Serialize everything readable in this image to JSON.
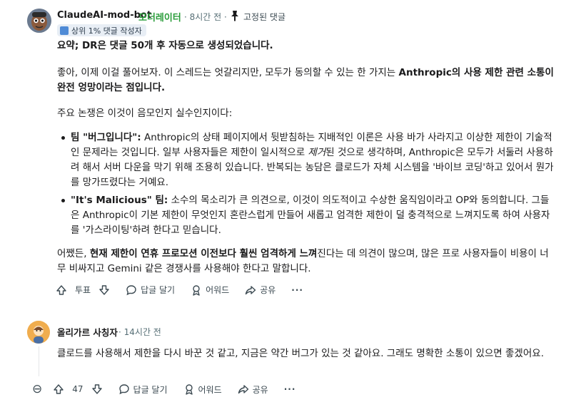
{
  "comment1": {
    "author": "ClaudeAI-mod-bot",
    "role_badge": "모더레이터",
    "meta": "· 8시간 전 ·",
    "pinned_label": "고정된 댓글",
    "top_badge": "상위 1% 댓글 작성자",
    "tldr": "요약; DR은 댓글 50개 후 자동으로 생성되었습니다.",
    "p1_normal": "좋아, 이제 이걸 풀어보자. 이 스레드는 엇갈리지만, 모두가 동의할 수 있는 한 가지는 ",
    "p1_bold": "Anthropic의 사용 제한 관련 소통이 완전 엉망이라는 점입니다.",
    "p2": "주요 논쟁은 이것이 음모인지 실수인지이다:",
    "bullet1_bold": "팀 \"버그입니다\":",
    "bullet1_a": " Anthropic의 상태 페이지에서 뒷받침하는 지배적인 이론은 사용 바가 사라지고 이상한 제한이 기술적인 문제라는 것입니다. 일부 사용자들은 제한이 일시적으로 ",
    "bullet1_italic": "제거",
    "bullet1_b": "된 것으로 생각하며, Anthropic은 모두가 서둘러 사용하려 해서 서버 다운을 막기 위해 조용히 있습니다. 반복되는 농담은 클로드가 자체 시스템을 '바이브 코딩'하고 있어서 뭔가를 망가뜨렸다는 거예요.",
    "bullet2_bold": "\"It's Malicious\" 팀:",
    "bullet2_text": " 소수의 목소리가 큰 의견으로, 이것이 의도적이고 수상한 움직임이라고 OP와 동의합니다. 그들은 Anthropic이 기본 제한이 무엇인지 혼란스럽게 만들어 새롭고 엄격한 제한이 덜 충격적으로 느껴지도록 하여 사용자를 '가스라이팅'하려 한다고 믿습니다.",
    "p3_a": "어쨌든, ",
    "p3_bold": "현재 제한이 연휴 프로모션 이전보다 훨씬 엄격하게 느껴",
    "p3_b": "진다는 데 의견이 많으며, 많은 프로 사용자들이 비용이 너무 비싸지고 Gemini 같은 경쟁사를 사용해야 한다고 말합니다.",
    "actions": {
      "vote_label": "투표",
      "reply_label": "답글 달기",
      "award_label": "어워드",
      "share_label": "공유",
      "more_label": "···"
    }
  },
  "comment2": {
    "author": "올리가르 사칭자",
    "meta": "· 14시간 전",
    "text": "클로드를 사용해서 제한을 다시 바꾼 것 같고, 지금은 약간 버그가 있는 것 같아요. 그래도 명확한 소통이 있으면 좋겠어요.",
    "actions": {
      "collapse_label": "⊖",
      "vote_count": "47",
      "reply_label": "답글 달기",
      "award_label": "어워드",
      "share_label": "공유",
      "more_label": "···"
    }
  },
  "colors": {
    "moderator_green": "#2a9d3a",
    "meta_gray": "#576f76",
    "badge_bg": "#e8eef5"
  }
}
